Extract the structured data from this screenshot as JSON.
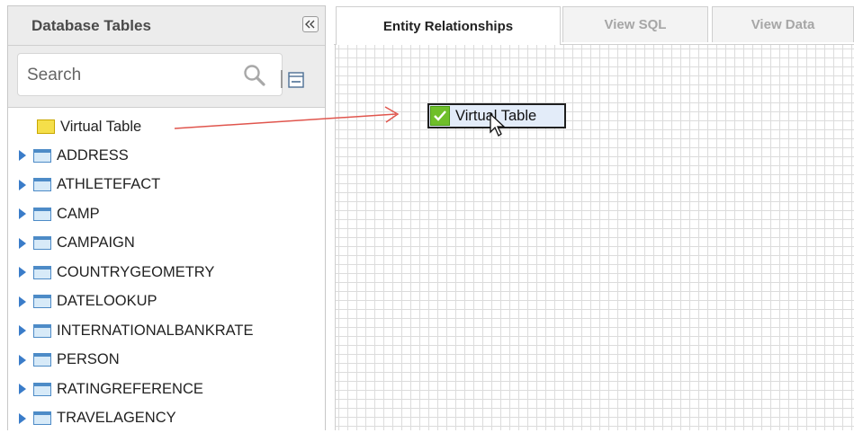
{
  "panel": {
    "title": "Database Tables",
    "collapse_icon": "double-chevron-left-icon",
    "search_placeholder": "Search",
    "tree_items": [
      {
        "label": "Virtual Table",
        "icon": "folder-icon",
        "expandable": false
      },
      {
        "label": "ADDRESS",
        "icon": "table-icon",
        "expandable": true
      },
      {
        "label": "ATHLETEFACT",
        "icon": "table-icon",
        "expandable": true
      },
      {
        "label": "CAMP",
        "icon": "table-icon",
        "expandable": true
      },
      {
        "label": "CAMPAIGN",
        "icon": "table-icon",
        "expandable": true
      },
      {
        "label": "COUNTRYGEOMETRY",
        "icon": "table-icon",
        "expandable": true
      },
      {
        "label": "DATELOOKUP",
        "icon": "table-icon",
        "expandable": true
      },
      {
        "label": "INTERNATIONALBANKRATE",
        "icon": "table-icon",
        "expandable": true
      },
      {
        "label": "PERSON",
        "icon": "table-icon",
        "expandable": true
      },
      {
        "label": "RATINGREFERENCE",
        "icon": "table-icon",
        "expandable": true
      },
      {
        "label": "TRAVELAGENCY",
        "icon": "table-icon",
        "expandable": true
      }
    ]
  },
  "tabs": [
    {
      "label": "Entity Relationships",
      "active": true
    },
    {
      "label": "View SQL",
      "active": false
    },
    {
      "label": "View Data",
      "active": false
    }
  ],
  "canvas": {
    "node_label": "Virtual Table",
    "node_icon": "checkmark-icon",
    "arrow_color": "#e0554d"
  },
  "colors": {
    "accent_blue": "#3a7cc9",
    "check_green": "#6fbf2a",
    "node_fill": "#e3ecf9"
  }
}
